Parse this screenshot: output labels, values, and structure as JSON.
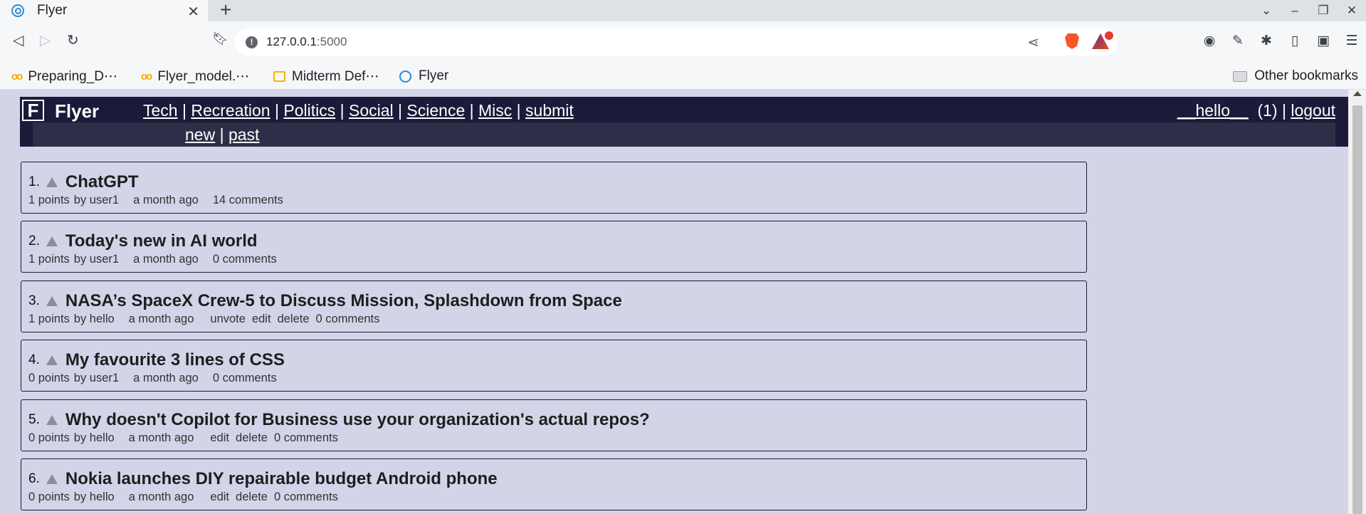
{
  "browser": {
    "tab": {
      "title": "Flyer",
      "favicon": "flyer-swirl-icon"
    },
    "url": {
      "host": "127.0.0.1",
      "port": ":5000"
    },
    "bookmarks": [
      {
        "label": "Preparing_D⋯",
        "icon": "colab-icon"
      },
      {
        "label": "Flyer_model.⋯",
        "icon": "colab-icon"
      },
      {
        "label": "Midterm Def⋯",
        "icon": "slides-icon"
      },
      {
        "label": "Flyer",
        "icon": "flyer-swirl-icon"
      }
    ],
    "other_bookmarks": "Other bookmarks"
  },
  "site": {
    "logo": "F",
    "name": "Flyer",
    "categories": [
      "Tech",
      "Recreation",
      "Politics",
      "Social",
      "Science",
      "Misc",
      "submit"
    ],
    "separator": "|",
    "subnav": [
      "new",
      "past"
    ],
    "user": {
      "name": "__hello__",
      "karma": "(1)",
      "logout": "logout"
    }
  },
  "stories": [
    {
      "rank": "1.",
      "title": "ChatGPT",
      "points": "1 points",
      "by": "by user1",
      "age": "a month ago",
      "actions": [],
      "comments": "14 comments"
    },
    {
      "rank": "2.",
      "title": "Today's new in AI world",
      "points": "1 points",
      "by": "by user1",
      "age": "a month ago",
      "actions": [],
      "comments": "0 comments"
    },
    {
      "rank": "3.",
      "title": "NASA’s SpaceX Crew-5 to Discuss Mission, Splashdown from Space",
      "points": "1 points",
      "by": "by hello",
      "age": "a month ago",
      "actions": [
        "unvote",
        "edit",
        "delete"
      ],
      "comments": "0 comments"
    },
    {
      "rank": "4.",
      "title": "My favourite 3 lines of CSS",
      "points": "0 points",
      "by": "by user1",
      "age": "a month ago",
      "actions": [],
      "comments": "0 comments"
    },
    {
      "rank": "5.",
      "title": "Why doesn't Copilot for Business use your organization's actual repos?",
      "points": "0 points",
      "by": "by hello",
      "age": "a month ago",
      "actions": [
        "edit",
        "delete"
      ],
      "comments": "0 comments"
    },
    {
      "rank": "6.",
      "title": "Nokia launches DIY repairable budget Android phone",
      "points": "0 points",
      "by": "by hello",
      "age": "a month ago",
      "actions": [
        "edit",
        "delete"
      ],
      "comments": "0 comments"
    }
  ],
  "colors": {
    "header_bg": "#1a1a3a",
    "subbar_bg": "#2e2e48",
    "page_bg": "#d2d4e8"
  }
}
